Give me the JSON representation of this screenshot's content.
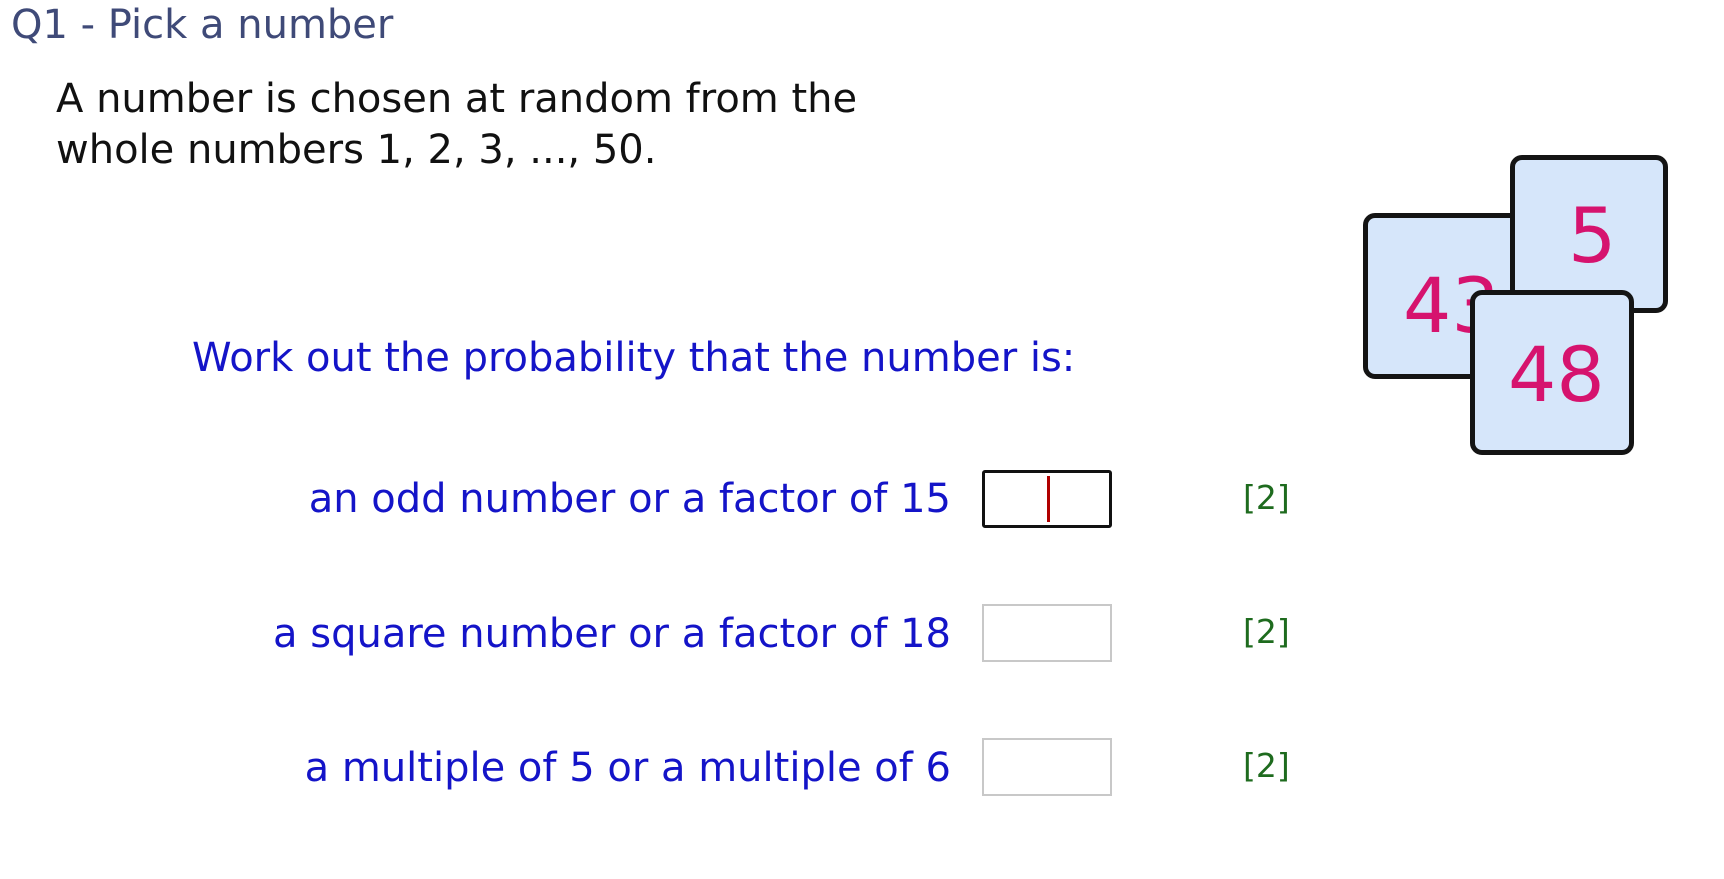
{
  "question": {
    "title": "Q1 - Pick a number",
    "intro_line1": "A number is chosen at random from the",
    "intro_line2": "whole numbers 1, 2, 3, ..., 50.",
    "prompt": "Work out the probability that the number is:"
  },
  "parts": [
    {
      "label": "an odd number or a factor of 15",
      "answer": "",
      "marks": "[2]"
    },
    {
      "label": "a square number or a factor of 18",
      "answer": "",
      "marks": "[2]"
    },
    {
      "label": "a multiple of 5 or a multiple of 6",
      "answer": "",
      "marks": "[2]"
    }
  ],
  "cards": {
    "back": "43",
    "right": "5",
    "front": "48"
  },
  "colors": {
    "title": "#3f4a78",
    "prompt": "#1414c8",
    "marks": "#1e6b1e",
    "card_fill": "#d6e6fa",
    "card_number": "#d6136e"
  }
}
